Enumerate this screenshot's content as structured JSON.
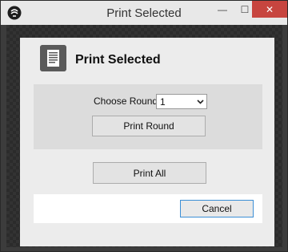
{
  "window": {
    "title": "Print Selected",
    "controls": {
      "minimize": "—",
      "maximize": "☐",
      "close": "✕"
    }
  },
  "header": {
    "title": "Print Selected",
    "icon": "document-icon"
  },
  "round": {
    "label": "Choose Round",
    "selected": "1"
  },
  "buttons": {
    "print_round": "Print Round",
    "print_all": "Print All",
    "cancel": "Cancel"
  },
  "colors": {
    "close_button": "#c7453f",
    "focus_border": "#3c8fd6"
  }
}
